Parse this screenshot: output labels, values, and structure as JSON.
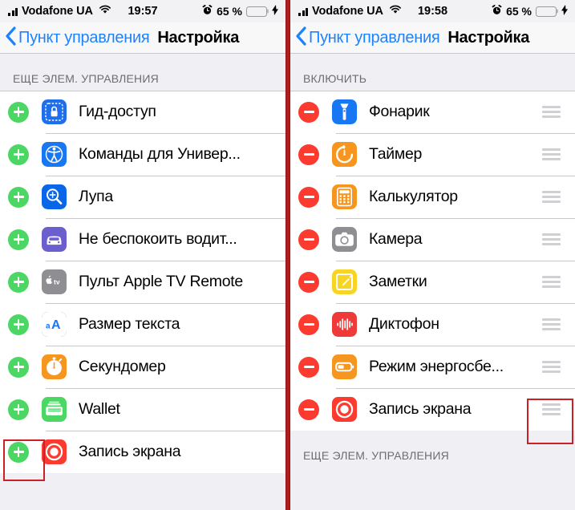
{
  "panels": [
    {
      "id": "left",
      "status_bar": {
        "signal_icon": "signal-bars-icon",
        "carrier": "Vodafone UA",
        "wifi_icon": "wifi-icon",
        "time": "19:57",
        "alarm_icon": "alarm-clock-icon",
        "battery_percent": "65 %",
        "battery_level": 65,
        "battery_color": "#ffcc00",
        "charging_icon": "lightning-bolt-icon"
      },
      "nav": {
        "back_icon": "chevron-left-icon",
        "back_label": "Пункт управления",
        "title": "Настройка"
      },
      "section_header": "ЕЩЕ ЭЛЕМ. УПРАВЛЕНИЯ",
      "rows": [
        {
          "toggle": "add",
          "icon": "guided-access-icon",
          "icon_bg": "#1f6fec",
          "label": "Гид-доступ",
          "handle": false
        },
        {
          "toggle": "add",
          "icon": "accessibility-shortcuts-icon",
          "icon_bg": "#1877f2",
          "label": "Команды для Универ...",
          "handle": false
        },
        {
          "toggle": "add",
          "icon": "magnifier-icon",
          "icon_bg": "#0a66e8",
          "label": "Лупа",
          "handle": false
        },
        {
          "toggle": "add",
          "icon": "do-not-disturb-while-driving-icon",
          "icon_bg": "#6b5ecf",
          "label": "Не беспокоить водит...",
          "handle": false
        },
        {
          "toggle": "add",
          "icon": "apple-tv-remote-icon",
          "icon_bg": "#8e8e93",
          "label": "Пульт Apple TV Remote",
          "handle": false
        },
        {
          "toggle": "add",
          "icon": "text-size-icon",
          "icon_bg": "#1877f2",
          "label": "Размер текста",
          "handle": false
        },
        {
          "toggle": "add",
          "icon": "stopwatch-icon",
          "icon_bg": "#f7961e",
          "label": "Секундомер",
          "handle": false
        },
        {
          "toggle": "add",
          "icon": "wallet-icon",
          "icon_bg": "#4cd764",
          "label": "Wallet",
          "handle": false
        },
        {
          "toggle": "add",
          "icon": "screen-recording-icon",
          "icon_bg": "#fc3b30",
          "label": "Запись экрана",
          "handle": false
        }
      ],
      "highlight": "add-button-screen-recording"
    },
    {
      "id": "right",
      "status_bar": {
        "signal_icon": "signal-bars-icon",
        "carrier": "Vodafone UA",
        "wifi_icon": "wifi-icon",
        "time": "19:58",
        "alarm_icon": "alarm-clock-icon",
        "battery_percent": "65 %",
        "battery_level": 65,
        "battery_color": "#ffcc00",
        "charging_icon": "lightning-bolt-icon"
      },
      "nav": {
        "back_icon": "chevron-left-icon",
        "back_label": "Пункт управления",
        "title": "Настройка"
      },
      "section_header": "ВКЛЮЧИТЬ",
      "rows": [
        {
          "toggle": "remove",
          "icon": "flashlight-icon",
          "icon_bg": "#1877f2",
          "label": "Фонарик",
          "handle": true
        },
        {
          "toggle": "remove",
          "icon": "timer-icon",
          "icon_bg": "#f7961e",
          "label": "Таймер",
          "handle": true
        },
        {
          "toggle": "remove",
          "icon": "calculator-icon",
          "icon_bg": "#f7961e",
          "label": "Калькулятор",
          "handle": true
        },
        {
          "toggle": "remove",
          "icon": "camera-icon",
          "icon_bg": "#8e8e93",
          "label": "Камера",
          "handle": true
        },
        {
          "toggle": "remove",
          "icon": "notes-icon",
          "icon_bg": "#f8d525",
          "label": "Заметки",
          "handle": true
        },
        {
          "toggle": "remove",
          "icon": "voice-memos-icon",
          "icon_bg": "#ef3a3a",
          "label": "Диктофон",
          "handle": true
        },
        {
          "toggle": "remove",
          "icon": "low-power-mode-icon",
          "icon_bg": "#f7961e",
          "label": "Режим энергосбе...",
          "handle": true
        },
        {
          "toggle": "remove",
          "icon": "screen-recording-icon",
          "icon_bg": "#fc3b30",
          "label": "Запись экрана",
          "handle": true
        }
      ],
      "footer_section_header": "ЕЩЕ ЭЛЕМ. УПРАВЛЕНИЯ",
      "highlight": "drag-handle-screen-recording"
    }
  ],
  "colors": {
    "accent_blue": "#007aff",
    "add_green": "#4cd764",
    "remove_red": "#fc3b30",
    "highlight_red": "#cc2027",
    "divider_red": "#b41b1b",
    "group_bg": "#efeff4"
  }
}
